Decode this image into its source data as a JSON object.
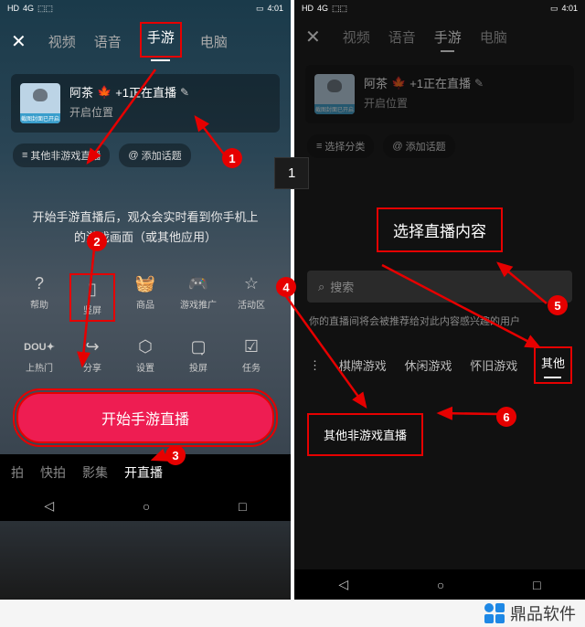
{
  "status": {
    "net1": "HD",
    "net2": "4G",
    "sig": "⬚⬚",
    "batt": "▭",
    "time": "4:01"
  },
  "tabs": [
    "视频",
    "语音",
    "手游",
    "电脑"
  ],
  "active_tab": "手游",
  "card": {
    "title_prefix": "阿茶",
    "title_suffix": "+1正在直播",
    "subtitle": "开启位置",
    "avatar_label": "截图封面已开启"
  },
  "left_chips": {
    "cat": "其他非游戏直播",
    "topic": "添加话题"
  },
  "right_chips": {
    "cat": "选择分类",
    "topic": "添加话题"
  },
  "help": "开始手游直播后，观众会实时看到你手机上的游戏画面（或其他应用）",
  "icons_row1": [
    {
      "name": "help-icon",
      "glyph": "?",
      "label": "帮助"
    },
    {
      "name": "portrait-icon",
      "glyph": "▯",
      "label": "竖屏"
    },
    {
      "name": "shop-icon",
      "glyph": "🧺",
      "label": "商品"
    },
    {
      "name": "promo-icon",
      "glyph": "🎮",
      "label": "游戏推广"
    },
    {
      "name": "star-icon",
      "glyph": "☆",
      "label": "活动区"
    }
  ],
  "icons_row2": [
    {
      "name": "dou-icon",
      "glyph": "DOU✦",
      "label": "上热门"
    },
    {
      "name": "share-icon",
      "glyph": "↪",
      "label": "分享"
    },
    {
      "name": "settings-icon",
      "glyph": "⬡",
      "label": "设置"
    },
    {
      "name": "cast-icon",
      "glyph": "▢̣",
      "label": "投屏"
    },
    {
      "name": "task-icon",
      "glyph": "☑",
      "label": "任务"
    }
  ],
  "start_button": "开始手游直播",
  "bottom_tabs": [
    "拍",
    "快拍",
    "影集",
    "开直播"
  ],
  "bottom_active": "开直播",
  "panel": {
    "title": "选择直播内容",
    "search_placeholder": "搜索",
    "hint": "你的直播间将会被推荐给对此内容感兴趣的用户",
    "cats": [
      "⋮",
      "棋牌游戏",
      "休闲游戏",
      "怀旧游戏",
      "其他"
    ],
    "active_cat": "其他",
    "result": "其他非游戏直播"
  },
  "badges": {
    "b1": "1",
    "b2": "2",
    "b3": "3",
    "b4": "4",
    "b5": "5",
    "b6": "6",
    "box1": "1"
  },
  "watermark": "鼎品软件"
}
